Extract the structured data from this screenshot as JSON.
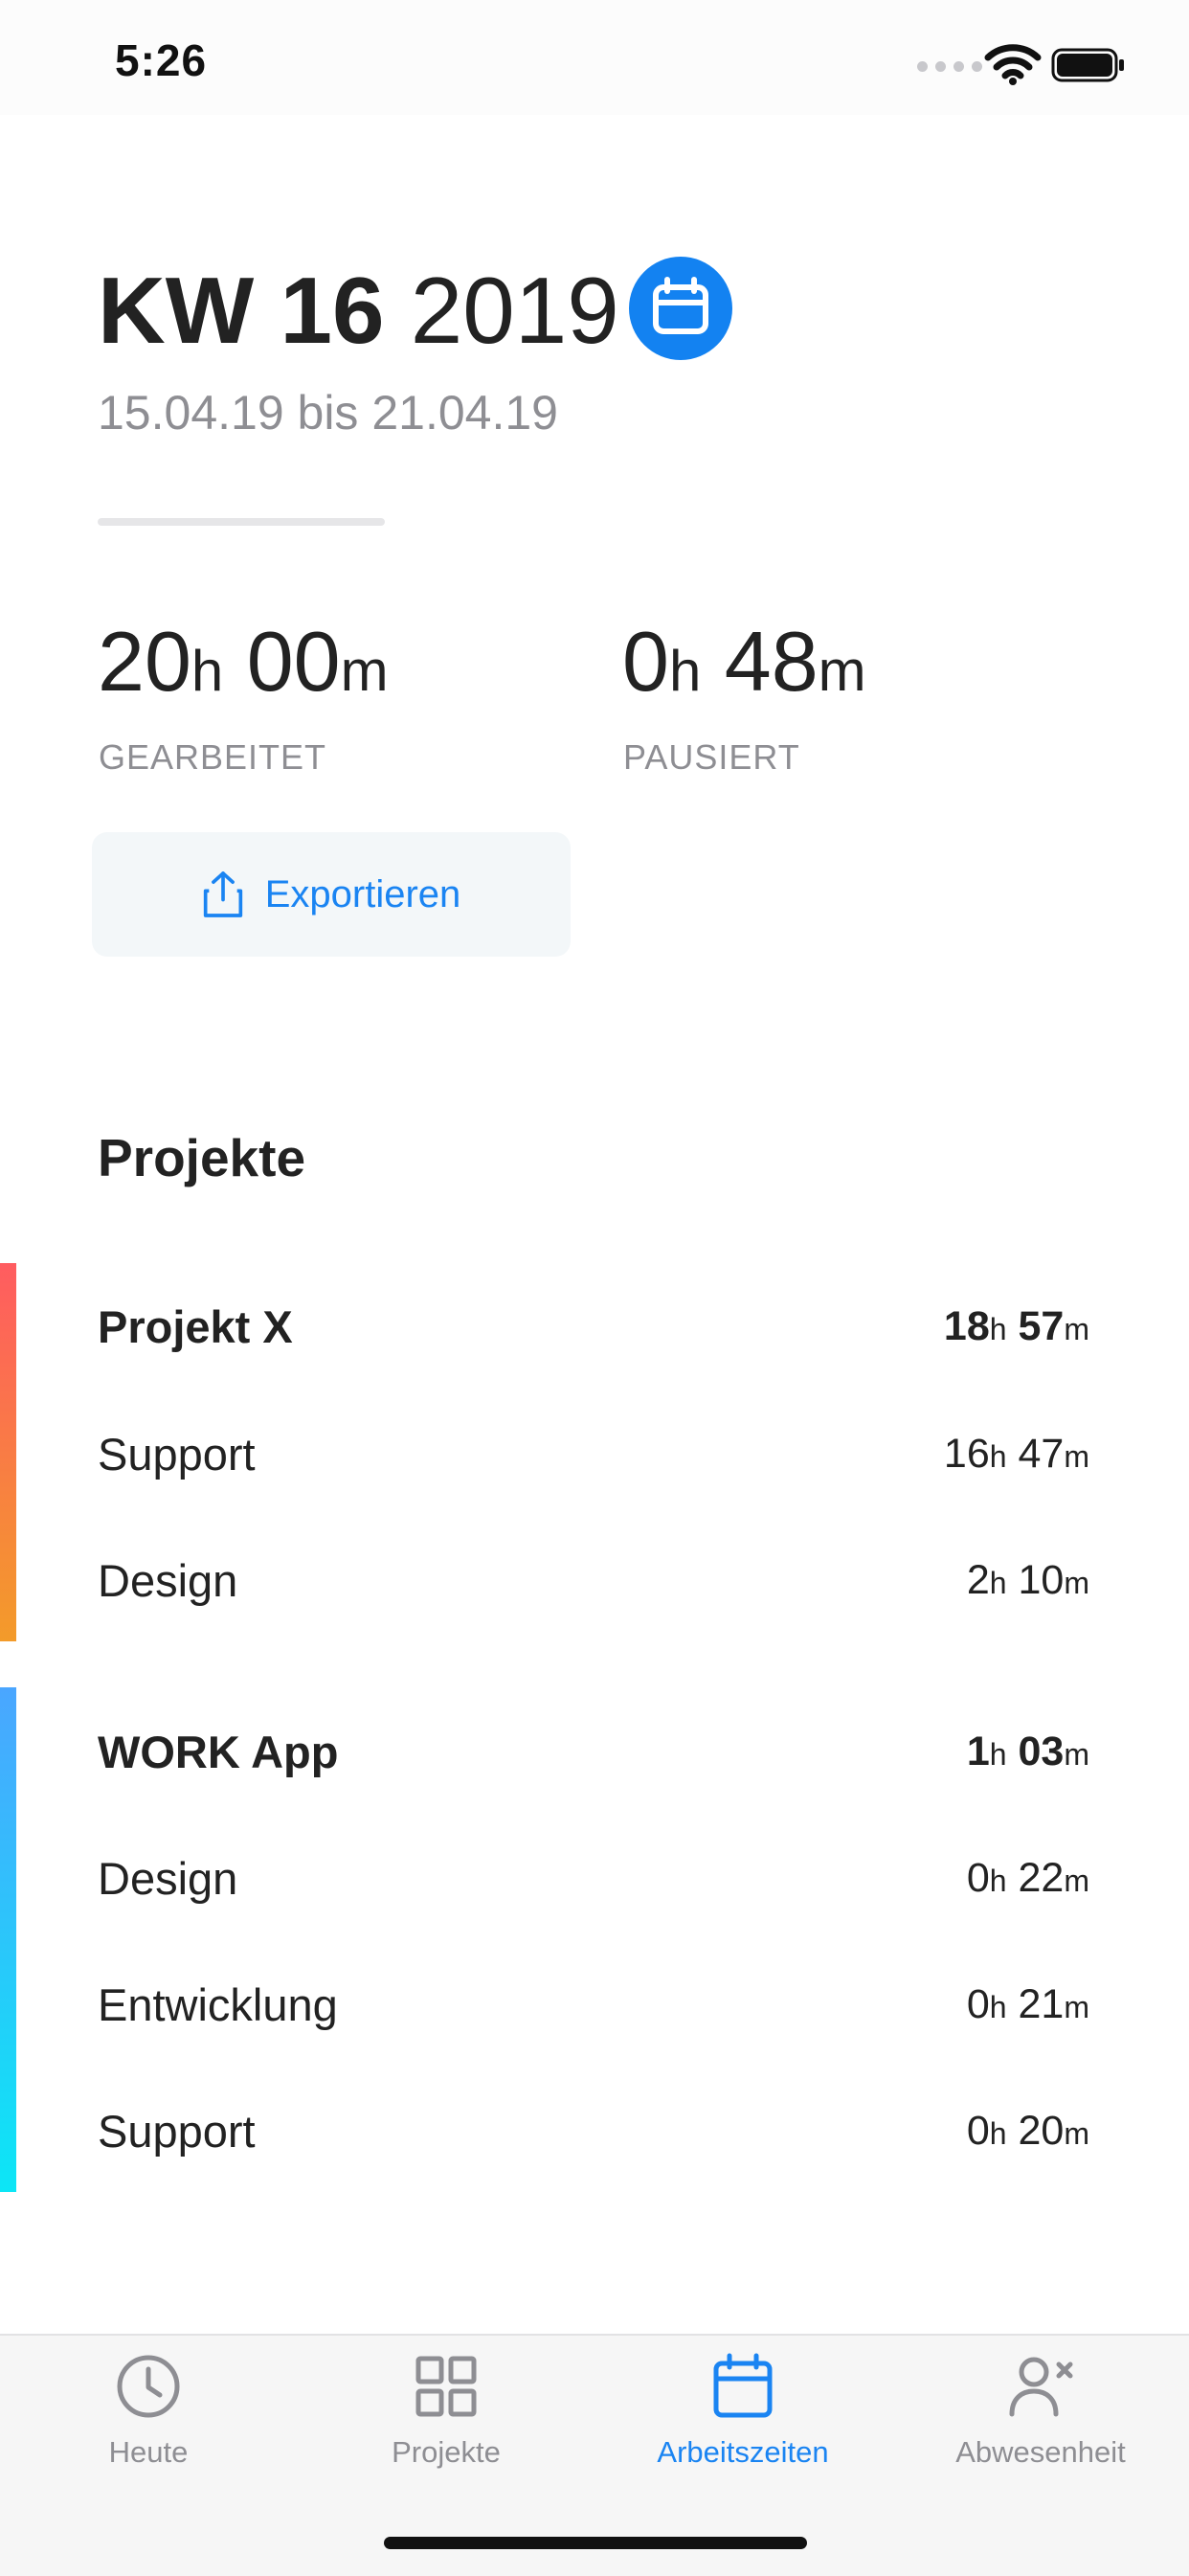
{
  "status_bar": {
    "time": "5:26"
  },
  "header": {
    "week_label": "KW 16",
    "year": "2019",
    "date_range": "15.04.19 bis 21.04.19"
  },
  "stats": {
    "worked": {
      "hours": "20",
      "minutes": "00",
      "h_unit": "h",
      "m_unit": "m",
      "label": "GEARBEITET"
    },
    "paused": {
      "hours": "0",
      "minutes": "48",
      "h_unit": "h",
      "m_unit": "m",
      "label": "PAUSIERT"
    }
  },
  "export_button": {
    "label": "Exportieren"
  },
  "projects": {
    "title": "Projekte",
    "groups": [
      {
        "name": "Projekt X",
        "hours": "18",
        "minutes": "57",
        "color_from": "#ff5c60",
        "color_to": "#f39b2a",
        "items": [
          {
            "name": "Support",
            "hours": "16",
            "minutes": "47"
          },
          {
            "name": "Design",
            "hours": "2",
            "minutes": "10"
          }
        ]
      },
      {
        "name": "WORK App",
        "hours": "1",
        "minutes": "03",
        "color_from": "#4aa6ff",
        "color_to": "#0ce6f6",
        "items": [
          {
            "name": "Design",
            "hours": "0",
            "minutes": "22"
          },
          {
            "name": "Entwicklung",
            "hours": "0",
            "minutes": "21"
          },
          {
            "name": "Support",
            "hours": "0",
            "minutes": "20"
          }
        ]
      }
    ],
    "h_unit": "h",
    "m_unit": "m"
  },
  "tab_bar": {
    "tabs": [
      {
        "label": "Heute",
        "icon": "clock-icon",
        "active": false
      },
      {
        "label": "Projekte",
        "icon": "grid-icon",
        "active": false
      },
      {
        "label": "Arbeitszeiten",
        "icon": "calendar-icon",
        "active": true
      },
      {
        "label": "Abwesenheit",
        "icon": "person-x-icon",
        "active": false
      }
    ]
  },
  "colors": {
    "accent": "#1382f1",
    "text": "#222222",
    "secondary": "#8e8e93"
  }
}
